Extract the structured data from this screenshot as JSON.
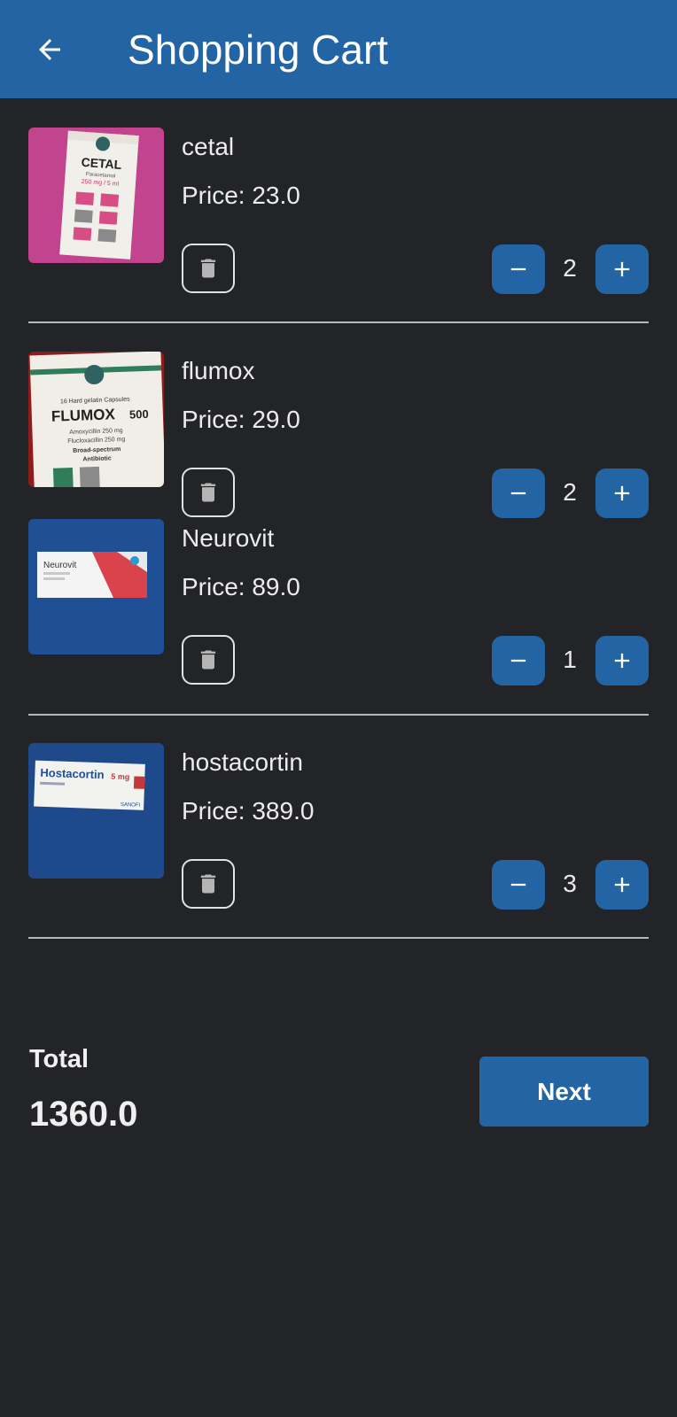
{
  "appbar": {
    "title": "Shopping Cart",
    "back_icon": "arrow-left-icon"
  },
  "items": [
    {
      "name": "cetal",
      "price": "Price: 23.0",
      "qty": "2",
      "image": "cetal-box",
      "image_text": {
        "brand": "CETAL",
        "line1": "Paracetamol",
        "line2": "250 mg / 5 ml"
      }
    },
    {
      "name": "flumox",
      "price": "Price: 29.0",
      "qty": "2",
      "image": "flumox-box",
      "image_text": {
        "caps": "16 Hard gelatin Capsules",
        "brand": "FLUMOX",
        "dose": "500",
        "l1": "Amoxycillin 250 mg",
        "l2": "Flucloxacillin 250 mg",
        "l3": "Broad-spectrum",
        "l4": "Antibiotic"
      }
    },
    {
      "name": "Neurovit",
      "price": "Price: 89.0",
      "qty": "1",
      "image": "neurovit-box",
      "image_text": {
        "brand": "Neurovit"
      }
    },
    {
      "name": "hostacortin",
      "price": "Price: 389.0",
      "qty": "3",
      "image": "hostacortin-box",
      "image_text": {
        "brand": "Hostacortin",
        "dose": "5 mg",
        "maker": "SANOFI"
      }
    }
  ],
  "footer": {
    "total_label": "Total",
    "total_value": "1360.0",
    "next_label": "Next"
  },
  "colors": {
    "primary": "#2364a5",
    "background": "#232427",
    "divider": "#b8b8b8"
  }
}
